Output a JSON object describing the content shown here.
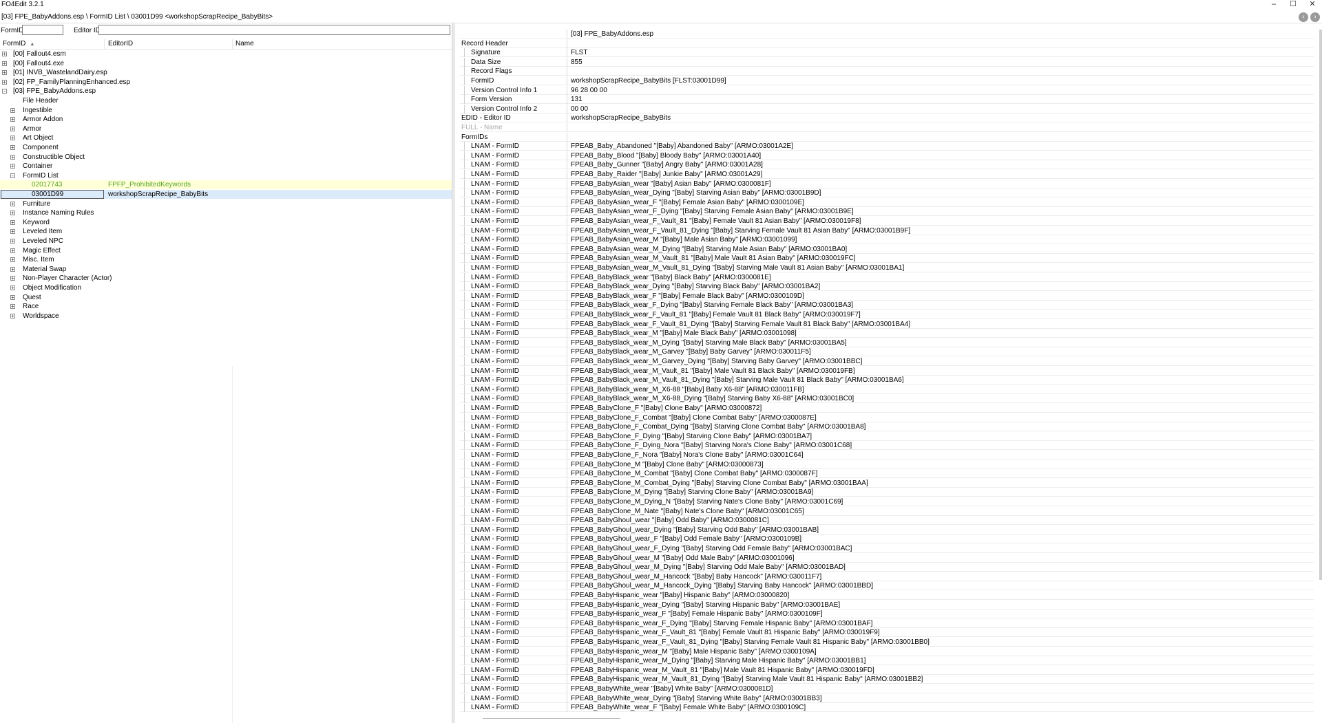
{
  "window": {
    "title": "FO4Edit 3.2.1",
    "minimize": "–",
    "maximize": "☐",
    "close": "✕"
  },
  "path_bar": {
    "text": "[03] FPE_BabyAddons.esp \\ FormID List \\ 03001D99 <workshopScrapRecipe_BabyBits>",
    "back": "‹",
    "forward": "›"
  },
  "filter": {
    "formid_label": "FormID",
    "formid_value": "",
    "editorid_label": "Editor ID",
    "editorid_value": ""
  },
  "columns": {
    "formid": "FormID",
    "editorid": "EditorID",
    "name": "Name"
  },
  "tree": [
    {
      "level": 0,
      "exp": "+",
      "label": "[00] Fallout4.esm",
      "edid": "",
      "state": ""
    },
    {
      "level": 0,
      "exp": "+",
      "label": "[00] Fallout4.exe",
      "edid": "",
      "state": ""
    },
    {
      "level": 0,
      "exp": "+",
      "label": "[01] INVB_WastelandDairy.esp",
      "edid": "",
      "state": ""
    },
    {
      "level": 0,
      "exp": "+",
      "label": "[02] FP_FamilyPlanningEnhanced.esp",
      "edid": "",
      "state": ""
    },
    {
      "level": 0,
      "exp": "-",
      "label": "[03] FPE_BabyAddons.esp",
      "edid": "",
      "state": ""
    },
    {
      "level": 1,
      "exp": "",
      "label": "File Header",
      "edid": "",
      "state": ""
    },
    {
      "level": 1,
      "exp": "+",
      "label": "Ingestible",
      "edid": "",
      "state": ""
    },
    {
      "level": 1,
      "exp": "+",
      "label": "Armor Addon",
      "edid": "",
      "state": ""
    },
    {
      "level": 1,
      "exp": "+",
      "label": "Armor",
      "edid": "",
      "state": ""
    },
    {
      "level": 1,
      "exp": "+",
      "label": "Art Object",
      "edid": "",
      "state": ""
    },
    {
      "level": 1,
      "exp": "+",
      "label": "Component",
      "edid": "",
      "state": ""
    },
    {
      "level": 1,
      "exp": "+",
      "label": "Constructible Object",
      "edid": "",
      "state": ""
    },
    {
      "level": 1,
      "exp": "+",
      "label": "Container",
      "edid": "",
      "state": ""
    },
    {
      "level": 1,
      "exp": "-",
      "label": "FormID List",
      "edid": "",
      "state": ""
    },
    {
      "level": 2,
      "exp": "",
      "label": "02017743",
      "edid": "FPFP_ProhibitedKeywords",
      "state": "hl"
    },
    {
      "level": 2,
      "exp": "",
      "label": "03001D99",
      "edid": "workshopScrapRecipe_BabyBits",
      "state": "sel"
    },
    {
      "level": 1,
      "exp": "+",
      "label": "Furniture",
      "edid": "",
      "state": ""
    },
    {
      "level": 1,
      "exp": "+",
      "label": "Instance Naming Rules",
      "edid": "",
      "state": ""
    },
    {
      "level": 1,
      "exp": "+",
      "label": "Keyword",
      "edid": "",
      "state": ""
    },
    {
      "level": 1,
      "exp": "+",
      "label": "Leveled Item",
      "edid": "",
      "state": ""
    },
    {
      "level": 1,
      "exp": "+",
      "label": "Leveled NPC",
      "edid": "",
      "state": ""
    },
    {
      "level": 1,
      "exp": "+",
      "label": "Magic Effect",
      "edid": "",
      "state": ""
    },
    {
      "level": 1,
      "exp": "+",
      "label": "Misc. Item",
      "edid": "",
      "state": ""
    },
    {
      "level": 1,
      "exp": "+",
      "label": "Material Swap",
      "edid": "",
      "state": ""
    },
    {
      "level": 1,
      "exp": "+",
      "label": "Non-Player Character (Actor)",
      "edid": "",
      "state": ""
    },
    {
      "level": 1,
      "exp": "+",
      "label": "Object Modification",
      "edid": "",
      "state": ""
    },
    {
      "level": 1,
      "exp": "+",
      "label": "Quest",
      "edid": "",
      "state": ""
    },
    {
      "level": 1,
      "exp": "+",
      "label": "Race",
      "edid": "",
      "state": ""
    },
    {
      "level": 1,
      "exp": "+",
      "label": "Worldspace",
      "edid": "",
      "state": ""
    }
  ],
  "record": [
    {
      "indent": 0,
      "name": "",
      "value": "[03] FPE_BabyAddons.esp",
      "state": ""
    },
    {
      "indent": 0,
      "name": "Record Header",
      "value": "",
      "state": ""
    },
    {
      "indent": 1,
      "name": "Signature",
      "value": "FLST",
      "state": ""
    },
    {
      "indent": 1,
      "name": "Data Size",
      "value": "855",
      "state": ""
    },
    {
      "indent": 1,
      "name": "Record Flags",
      "value": "",
      "state": ""
    },
    {
      "indent": 1,
      "name": "FormID",
      "value": "workshopScrapRecipe_BabyBits [FLST:03001D99]",
      "state": ""
    },
    {
      "indent": 1,
      "name": "Version Control Info 1",
      "value": "96 28 00 00",
      "state": ""
    },
    {
      "indent": 1,
      "name": "Form Version",
      "value": "131",
      "state": ""
    },
    {
      "indent": 1,
      "name": "Version Control Info 2",
      "value": "00 00",
      "state": ""
    },
    {
      "indent": 0,
      "name": "EDID - Editor ID",
      "value": "workshopScrapRecipe_BabyBits",
      "state": ""
    },
    {
      "indent": 0,
      "name": "FULL - Name",
      "value": "",
      "state": "greyed"
    },
    {
      "indent": 0,
      "name": "FormIDs",
      "value": "",
      "state": ""
    },
    {
      "indent": 1,
      "name": "LNAM - FormID",
      "value": "FPEAB_Baby_Abandoned \"[Baby] Abandoned Baby\" [ARMO:03001A2E]",
      "state": ""
    },
    {
      "indent": 1,
      "name": "LNAM - FormID",
      "value": "FPEAB_Baby_Blood \"[Baby] Bloody Baby\" [ARMO:03001A40]",
      "state": ""
    },
    {
      "indent": 1,
      "name": "LNAM - FormID",
      "value": "FPEAB_Baby_Gunner \"[Baby] Angry Baby\" [ARMO:03001A28]",
      "state": ""
    },
    {
      "indent": 1,
      "name": "LNAM - FormID",
      "value": "FPEAB_Baby_Raider \"[Baby] Junkie Baby\" [ARMO:03001A29]",
      "state": ""
    },
    {
      "indent": 1,
      "name": "LNAM - FormID",
      "value": "FPEAB_BabyAsian_wear \"[Baby] Asian Baby\" [ARMO:0300081F]",
      "state": ""
    },
    {
      "indent": 1,
      "name": "LNAM - FormID",
      "value": "FPEAB_BabyAsian_wear_Dying \"[Baby] Starving Asian Baby\" [ARMO:03001B9D]",
      "state": ""
    },
    {
      "indent": 1,
      "name": "LNAM - FormID",
      "value": "FPEAB_BabyAsian_wear_F \"[Baby] Female Asian Baby\" [ARMO:0300109E]",
      "state": ""
    },
    {
      "indent": 1,
      "name": "LNAM - FormID",
      "value": "FPEAB_BabyAsian_wear_F_Dying \"[Baby] Starving Female Asian Baby\" [ARMO:03001B9E]",
      "state": ""
    },
    {
      "indent": 1,
      "name": "LNAM - FormID",
      "value": "FPEAB_BabyAsian_wear_F_Vault_81 \"[Baby] Female Vault 81 Asian Baby\" [ARMO:030019F8]",
      "state": ""
    },
    {
      "indent": 1,
      "name": "LNAM - FormID",
      "value": "FPEAB_BabyAsian_wear_F_Vault_81_Dying \"[Baby] Starving Female Vault 81 Asian Baby\" [ARMO:03001B9F]",
      "state": ""
    },
    {
      "indent": 1,
      "name": "LNAM - FormID",
      "value": "FPEAB_BabyAsian_wear_M \"[Baby] Male Asian Baby\" [ARMO:03001099]",
      "state": ""
    },
    {
      "indent": 1,
      "name": "LNAM - FormID",
      "value": "FPEAB_BabyAsian_wear_M_Dying \"[Baby] Starving Male Asian Baby\" [ARMO:03001BA0]",
      "state": ""
    },
    {
      "indent": 1,
      "name": "LNAM - FormID",
      "value": "FPEAB_BabyAsian_wear_M_Vault_81 \"[Baby] Male Vault 81 Asian Baby\" [ARMO:030019FC]",
      "state": ""
    },
    {
      "indent": 1,
      "name": "LNAM - FormID",
      "value": "FPEAB_BabyAsian_wear_M_Vault_81_Dying \"[Baby] Starving Male Vault 81 Asian Baby\" [ARMO:03001BA1]",
      "state": ""
    },
    {
      "indent": 1,
      "name": "LNAM - FormID",
      "value": "FPEAB_BabyBlack_wear \"[Baby] Black Baby\" [ARMO:0300081E]",
      "state": ""
    },
    {
      "indent": 1,
      "name": "LNAM - FormID",
      "value": "FPEAB_BabyBlack_wear_Dying \"[Baby] Starving Black Baby\" [ARMO:03001BA2]",
      "state": ""
    },
    {
      "indent": 1,
      "name": "LNAM - FormID",
      "value": "FPEAB_BabyBlack_wear_F \"[Baby] Female Black Baby\" [ARMO:0300109D]",
      "state": ""
    },
    {
      "indent": 1,
      "name": "LNAM - FormID",
      "value": "FPEAB_BabyBlack_wear_F_Dying \"[Baby] Starving Female Black Baby\" [ARMO:03001BA3]",
      "state": ""
    },
    {
      "indent": 1,
      "name": "LNAM - FormID",
      "value": "FPEAB_BabyBlack_wear_F_Vault_81 \"[Baby] Female Vault 81 Black Baby\" [ARMO:030019F7]",
      "state": ""
    },
    {
      "indent": 1,
      "name": "LNAM - FormID",
      "value": "FPEAB_BabyBlack_wear_F_Vault_81_Dying \"[Baby] Starving Female Vault 81 Black Baby\" [ARMO:03001BA4]",
      "state": ""
    },
    {
      "indent": 1,
      "name": "LNAM - FormID",
      "value": "FPEAB_BabyBlack_wear_M \"[Baby] Male Black Baby\" [ARMO:03001098]",
      "state": ""
    },
    {
      "indent": 1,
      "name": "LNAM - FormID",
      "value": "FPEAB_BabyBlack_wear_M_Dying \"[Baby] Starving Male Black Baby\" [ARMO:03001BA5]",
      "state": ""
    },
    {
      "indent": 1,
      "name": "LNAM - FormID",
      "value": "FPEAB_BabyBlack_wear_M_Garvey \"[Baby] Baby Garvey\" [ARMO:030011F5]",
      "state": ""
    },
    {
      "indent": 1,
      "name": "LNAM - FormID",
      "value": "FPEAB_BabyBlack_wear_M_Garvey_Dying \"[Baby] Starving Baby Garvey\" [ARMO:03001BBC]",
      "state": ""
    },
    {
      "indent": 1,
      "name": "LNAM - FormID",
      "value": "FPEAB_BabyBlack_wear_M_Vault_81 \"[Baby] Male Vault 81 Black Baby\" [ARMO:030019FB]",
      "state": ""
    },
    {
      "indent": 1,
      "name": "LNAM - FormID",
      "value": "FPEAB_BabyBlack_wear_M_Vault_81_Dying \"[Baby] Starving Male Vault 81 Black Baby\" [ARMO:03001BA6]",
      "state": ""
    },
    {
      "indent": 1,
      "name": "LNAM - FormID",
      "value": "FPEAB_BabyBlack_wear_M_X6-88 \"[Baby] Baby X6-88\" [ARMO:030011FB]",
      "state": ""
    },
    {
      "indent": 1,
      "name": "LNAM - FormID",
      "value": "FPEAB_BabyBlack_wear_M_X6-88_Dying \"[Baby] Starving Baby X6-88\" [ARMO:03001BC0]",
      "state": ""
    },
    {
      "indent": 1,
      "name": "LNAM - FormID",
      "value": "FPEAB_BabyClone_F \"[Baby] Clone Baby\" [ARMO:03000872]",
      "state": ""
    },
    {
      "indent": 1,
      "name": "LNAM - FormID",
      "value": "FPEAB_BabyClone_F_Combat \"[Baby] Clone Combat Baby\" [ARMO:0300087E]",
      "state": ""
    },
    {
      "indent": 1,
      "name": "LNAM - FormID",
      "value": "FPEAB_BabyClone_F_Combat_Dying \"[Baby] Starving Clone Combat Baby\" [ARMO:03001BA8]",
      "state": ""
    },
    {
      "indent": 1,
      "name": "LNAM - FormID",
      "value": "FPEAB_BabyClone_F_Dying \"[Baby] Starving Clone Baby\" [ARMO:03001BA7]",
      "state": ""
    },
    {
      "indent": 1,
      "name": "LNAM - FormID",
      "value": "FPEAB_BabyClone_F_Dying_Nora \"[Baby] Starving Nora's Clone Baby\" [ARMO:03001C68]",
      "state": ""
    },
    {
      "indent": 1,
      "name": "LNAM - FormID",
      "value": "FPEAB_BabyClone_F_Nora \"[Baby] Nora's Clone Baby\" [ARMO:03001C64]",
      "state": ""
    },
    {
      "indent": 1,
      "name": "LNAM - FormID",
      "value": "FPEAB_BabyClone_M \"[Baby] Clone Baby\" [ARMO:03000873]",
      "state": ""
    },
    {
      "indent": 1,
      "name": "LNAM - FormID",
      "value": "FPEAB_BabyClone_M_Combat \"[Baby] Clone Combat Baby\" [ARMO:0300087F]",
      "state": ""
    },
    {
      "indent": 1,
      "name": "LNAM - FormID",
      "value": "FPEAB_BabyClone_M_Combat_Dying \"[Baby] Starving Clone Combat Baby\" [ARMO:03001BAA]",
      "state": ""
    },
    {
      "indent": 1,
      "name": "LNAM - FormID",
      "value": "FPEAB_BabyClone_M_Dying \"[Baby] Starving Clone Baby\" [ARMO:03001BA9]",
      "state": ""
    },
    {
      "indent": 1,
      "name": "LNAM - FormID",
      "value": "FPEAB_BabyClone_M_Dying_N \"[Baby] Starving Nate's Clone Baby\" [ARMO:03001C69]",
      "state": ""
    },
    {
      "indent": 1,
      "name": "LNAM - FormID",
      "value": "FPEAB_BabyClone_M_Nate \"[Baby] Nate's Clone Baby\" [ARMO:03001C65]",
      "state": ""
    },
    {
      "indent": 1,
      "name": "LNAM - FormID",
      "value": "FPEAB_BabyGhoul_wear \"[Baby] Odd Baby\" [ARMO:0300081C]",
      "state": ""
    },
    {
      "indent": 1,
      "name": "LNAM - FormID",
      "value": "FPEAB_BabyGhoul_wear_Dying \"[Baby] Starving Odd Baby\" [ARMO:03001BAB]",
      "state": ""
    },
    {
      "indent": 1,
      "name": "LNAM - FormID",
      "value": "FPEAB_BabyGhoul_wear_F \"[Baby] Odd Female Baby\" [ARMO:0300109B]",
      "state": ""
    },
    {
      "indent": 1,
      "name": "LNAM - FormID",
      "value": "FPEAB_BabyGhoul_wear_F_Dying \"[Baby] Starving Odd Female Baby\" [ARMO:03001BAC]",
      "state": ""
    },
    {
      "indent": 1,
      "name": "LNAM - FormID",
      "value": "FPEAB_BabyGhoul_wear_M \"[Baby] Odd Male Baby\" [ARMO:03001096]",
      "state": ""
    },
    {
      "indent": 1,
      "name": "LNAM - FormID",
      "value": "FPEAB_BabyGhoul_wear_M_Dying \"[Baby] Starving Odd Male Baby\" [ARMO:03001BAD]",
      "state": ""
    },
    {
      "indent": 1,
      "name": "LNAM - FormID",
      "value": "FPEAB_BabyGhoul_wear_M_Hancock \"[Baby] Baby Hancock\" [ARMO:030011F7]",
      "state": ""
    },
    {
      "indent": 1,
      "name": "LNAM - FormID",
      "value": "FPEAB_BabyGhoul_wear_M_Hancock_Dying \"[Baby] Starving Baby Hancock\" [ARMO:03001BBD]",
      "state": ""
    },
    {
      "indent": 1,
      "name": "LNAM - FormID",
      "value": "FPEAB_BabyHispanic_wear \"[Baby] Hispanic Baby\" [ARMO:03000820]",
      "state": ""
    },
    {
      "indent": 1,
      "name": "LNAM - FormID",
      "value": "FPEAB_BabyHispanic_wear_Dying \"[Baby] Starving Hispanic Baby\" [ARMO:03001BAE]",
      "state": ""
    },
    {
      "indent": 1,
      "name": "LNAM - FormID",
      "value": "FPEAB_BabyHispanic_wear_F \"[Baby] Female Hispanic Baby\" [ARMO:0300109F]",
      "state": ""
    },
    {
      "indent": 1,
      "name": "LNAM - FormID",
      "value": "FPEAB_BabyHispanic_wear_F_Dying \"[Baby] Starving Female Hispanic Baby\" [ARMO:03001BAF]",
      "state": ""
    },
    {
      "indent": 1,
      "name": "LNAM - FormID",
      "value": "FPEAB_BabyHispanic_wear_F_Vault_81 \"[Baby] Female Vault 81 Hispanic Baby\" [ARMO:030019F9]",
      "state": ""
    },
    {
      "indent": 1,
      "name": "LNAM - FormID",
      "value": "FPEAB_BabyHispanic_wear_F_Vault_81_Dying \"[Baby] Starving Female Vault 81 Hispanic Baby\" [ARMO:03001BB0]",
      "state": ""
    },
    {
      "indent": 1,
      "name": "LNAM - FormID",
      "value": "FPEAB_BabyHispanic_wear_M \"[Baby] Male Hispanic Baby\" [ARMO:0300109A]",
      "state": ""
    },
    {
      "indent": 1,
      "name": "LNAM - FormID",
      "value": "FPEAB_BabyHispanic_wear_M_Dying \"[Baby] Starving Male Hispanic Baby\" [ARMO:03001BB1]",
      "state": ""
    },
    {
      "indent": 1,
      "name": "LNAM - FormID",
      "value": "FPEAB_BabyHispanic_wear_M_Vault_81 \"[Baby] Male Vault 81 Hispanic Baby\" [ARMO:030019FD]",
      "state": ""
    },
    {
      "indent": 1,
      "name": "LNAM - FormID",
      "value": "FPEAB_BabyHispanic_wear_M_Vault_81_Dying \"[Baby] Starving Male Vault 81 Hispanic Baby\" [ARMO:03001BB2]",
      "state": ""
    },
    {
      "indent": 1,
      "name": "LNAM - FormID",
      "value": "FPEAB_BabyWhite_wear \"[Baby] White Baby\" [ARMO:0300081D]",
      "state": ""
    },
    {
      "indent": 1,
      "name": "LNAM - FormID",
      "value": "FPEAB_BabyWhite_wear_Dying \"[Baby] Starving White Baby\" [ARMO:03001BB3]",
      "state": ""
    },
    {
      "indent": 1,
      "name": "LNAM - FormID",
      "value": "FPEAB_BabyWhite_wear_F \"[Baby] Female White Baby\" [ARMO:0300109C]",
      "state": ""
    }
  ]
}
